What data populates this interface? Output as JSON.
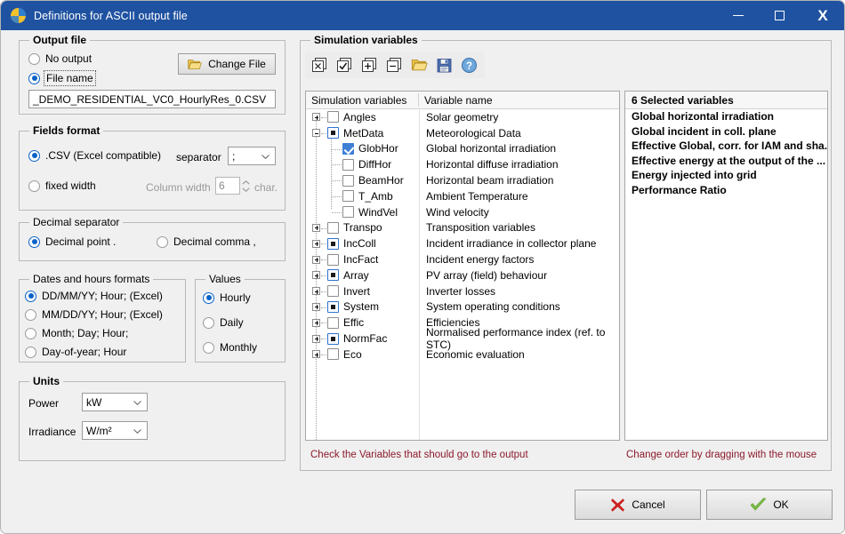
{
  "window": {
    "title": "Definitions for ASCII output file",
    "icon": "pvsyst-pie-icon",
    "minimize": "–",
    "maximize": "□",
    "close": "X"
  },
  "output_file": {
    "legend": "Output file",
    "no_output_label": "No output",
    "file_name_label": "File name",
    "selected": "file_name",
    "change_file_label": "Change File",
    "file_path_value": "_DEMO_RESIDENTIAL_VC0_HourlyRes_0.CSV"
  },
  "fields_format": {
    "legend": "Fields format",
    "csv_label": ".CSV (Excel compatible)",
    "fixed_label": "fixed width",
    "selected": "csv",
    "separator_label": "separator",
    "separator_value": ";",
    "column_width_label": "Column width",
    "column_width_value": "6",
    "char_label": "char."
  },
  "decimal_separator": {
    "legend": "Decimal separator",
    "point_label": "Decimal point .",
    "comma_label": "Decimal comma ,",
    "selected": "point"
  },
  "dates_formats": {
    "legend": "Dates and hours formats",
    "selected": 0,
    "options": [
      "DD/MM/YY; Hour;  (Excel)",
      "MM/DD/YY; Hour;  (Excel)",
      "Month; Day; Hour;",
      "Day-of-year; Hour"
    ]
  },
  "values": {
    "legend": "Values",
    "selected": 0,
    "options": [
      "Hourly",
      "Daily",
      "Monthly"
    ]
  },
  "units": {
    "legend": "Units",
    "power_label": "Power",
    "power_value": "kW",
    "irradiance_label": "Irradiance",
    "irradiance_value": "W/m²"
  },
  "simulation_variables": {
    "legend": "Simulation variables",
    "toolbar": [
      {
        "name": "uncheck-all-icon",
        "tip": "Uncheck all"
      },
      {
        "name": "check-all-icon",
        "tip": "Check all"
      },
      {
        "name": "expand-all-icon",
        "tip": "Expand all"
      },
      {
        "name": "collapse-all-icon",
        "tip": "Collapse all"
      },
      {
        "name": "open-folder-icon",
        "tip": "Open"
      },
      {
        "name": "save-disk-icon",
        "tip": "Save"
      },
      {
        "name": "help-icon",
        "tip": "Help"
      }
    ],
    "col1_header": "Simulation variables",
    "col2_header": "Variable name",
    "hint": "Check the Variables that should go to the output",
    "rows": [
      {
        "name": "Angles",
        "desc": "Solar geometry",
        "level": 0,
        "state": "unchecked",
        "expander": "plus"
      },
      {
        "name": "MetData",
        "desc": "Meteorological Data",
        "level": 0,
        "state": "partial",
        "expander": "minus"
      },
      {
        "name": "GlobHor",
        "desc": "Global horizontal irradiation",
        "level": 1,
        "state": "checked",
        "expander": "none"
      },
      {
        "name": "DiffHor",
        "desc": "Horizontal diffuse irradiation",
        "level": 1,
        "state": "unchecked",
        "expander": "none"
      },
      {
        "name": "BeamHor",
        "desc": "Horizontal beam irradiation",
        "level": 1,
        "state": "unchecked",
        "expander": "none"
      },
      {
        "name": "T_Amb",
        "desc": "Ambient Temperature",
        "level": 1,
        "state": "unchecked",
        "expander": "none"
      },
      {
        "name": "WindVel",
        "desc": "Wind velocity",
        "level": 1,
        "state": "unchecked",
        "expander": "none"
      },
      {
        "name": "Transpo",
        "desc": "Transposition variables",
        "level": 0,
        "state": "unchecked",
        "expander": "plus"
      },
      {
        "name": "IncColl",
        "desc": "Incident irradiance in collector plane",
        "level": 0,
        "state": "partial",
        "expander": "plus"
      },
      {
        "name": "IncFact",
        "desc": "Incident energy factors",
        "level": 0,
        "state": "unchecked",
        "expander": "plus"
      },
      {
        "name": "Array",
        "desc": "PV array (field) behaviour",
        "level": 0,
        "state": "partial",
        "expander": "plus"
      },
      {
        "name": "Invert",
        "desc": "Inverter losses",
        "level": 0,
        "state": "unchecked",
        "expander": "plus"
      },
      {
        "name": "System",
        "desc": "System operating conditions",
        "level": 0,
        "state": "partial",
        "expander": "plus"
      },
      {
        "name": "Effic",
        "desc": "Efficiencies",
        "level": 0,
        "state": "unchecked",
        "expander": "plus"
      },
      {
        "name": "NormFac",
        "desc": "Normalised performance index (ref. to STC)",
        "level": 0,
        "state": "partial",
        "expander": "plus"
      },
      {
        "name": "Eco",
        "desc": "Economic evaluation",
        "level": 0,
        "state": "unchecked",
        "expander": "plus"
      }
    ]
  },
  "selected_variables": {
    "header": "6 Selected variables",
    "hint": "Change order by dragging with the mouse",
    "items": [
      "Global horizontal irradiation",
      "Global incident in coll. plane",
      "Effective Global, corr. for IAM and sha...",
      "Effective energy at the output of the ...",
      "Energy injected into grid",
      "Performance Ratio"
    ]
  },
  "footer": {
    "cancel_label": "Cancel",
    "ok_label": "OK"
  },
  "colors": {
    "titlebar": "#1f52a0",
    "hint_text": "#8b1a2b",
    "accent_blue": "#0a62c7",
    "check_blue": "#3e7fd4",
    "cancel_red": "#cc1f1f",
    "ok_green": "#79bd43"
  }
}
